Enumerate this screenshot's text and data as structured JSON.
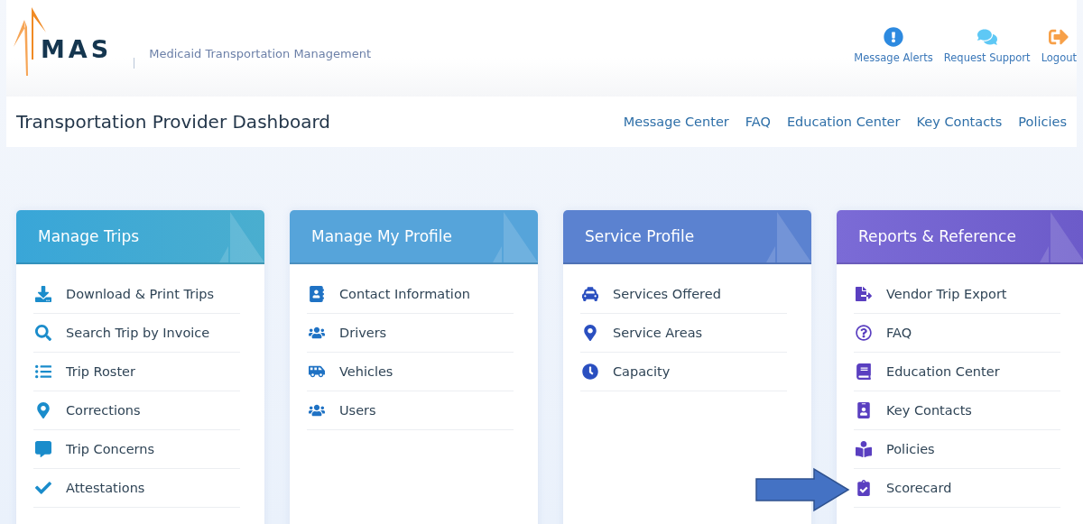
{
  "header": {
    "logo": "MAS",
    "tagline": "Medicaid Transportation Management",
    "actions": [
      {
        "label": "Message Alerts"
      },
      {
        "label": "Request Support"
      },
      {
        "label": "Logout"
      }
    ]
  },
  "nav": {
    "title": "Transportation Provider Dashboard",
    "links": [
      "Message Center",
      "FAQ",
      "Education Center",
      "Key Contacts",
      "Policies"
    ]
  },
  "cards": [
    {
      "title": "Manage Trips",
      "items": [
        "Download & Print Trips",
        "Search Trip by Invoice",
        "Trip Roster",
        "Corrections",
        "Trip Concerns",
        "Attestations"
      ]
    },
    {
      "title": "Manage My Profile",
      "items": [
        "Contact Information",
        "Drivers",
        "Vehicles",
        "Users"
      ]
    },
    {
      "title": "Service Profile",
      "items": [
        "Services Offered",
        "Service Areas",
        "Capacity"
      ]
    },
    {
      "title": "Reports & Reference",
      "items": [
        "Vendor Trip Export",
        "FAQ",
        "Education Center",
        "Key Contacts",
        "Policies",
        "Scorecard"
      ]
    }
  ]
}
